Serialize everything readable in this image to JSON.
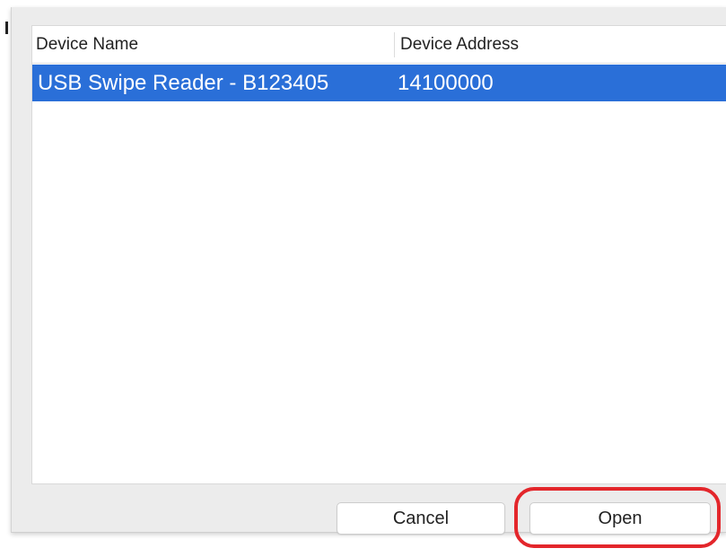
{
  "device_table": {
    "columns": [
      {
        "label": "Device Name"
      },
      {
        "label": "Device Address"
      }
    ],
    "rows": [
      {
        "name": "USB Swipe Reader - B123405",
        "address": "14100000",
        "selected": true
      }
    ]
  },
  "buttons": {
    "cancel_label": "Cancel",
    "open_label": "Open"
  },
  "colors": {
    "selection": "#2a6fd8",
    "annotation_ring": "#e3262b"
  }
}
